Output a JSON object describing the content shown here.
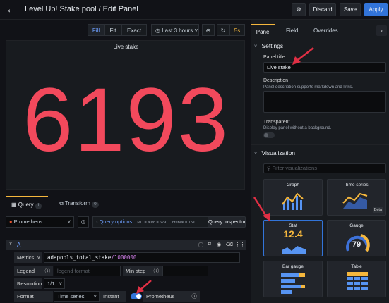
{
  "header": {
    "title": "Level Up! Stake pool / Edit Panel",
    "discard": "Discard",
    "save": "Save",
    "apply": "Apply"
  },
  "toolbar": {
    "fill": "Fill",
    "fit": "Fit",
    "exact": "Exact",
    "time_range": "Last 3 hours",
    "refresh": "5s"
  },
  "panel": {
    "title": "Live stake",
    "value": "6193",
    "value_color": "#f2495c"
  },
  "query_tabs": [
    {
      "label": "Query",
      "count": "1"
    },
    {
      "label": "Transform",
      "count": "0"
    }
  ],
  "query": {
    "datasource": "Prometheus",
    "options_link": "Query options",
    "md_info": "MD = auto = 679",
    "interval": "Interval = 15s",
    "inspector": "Query inspector",
    "ref": "A",
    "metrics_label": "Metrics",
    "metrics_value_name": "adapools_total_stake",
    "metrics_value_op": "/1000000",
    "legend_label": "Legend",
    "legend_placeholder": "legend format",
    "minstep_label": "Min step",
    "resolution_label": "Resolution",
    "resolution_value": "1/1",
    "format_label": "Format",
    "format_value": "Time series",
    "instant_label": "Instant",
    "prom_label": "Prometheus"
  },
  "side_tabs": [
    "Panel",
    "Field",
    "Overrides"
  ],
  "settings": {
    "section": "Settings",
    "panel_title_label": "Panel title",
    "panel_title_value": "Live stake",
    "description_label": "Description",
    "description_help": "Panel description supports markdown and links.",
    "transparent_label": "Transparent",
    "transparent_help": "Display panel without a background."
  },
  "visualization": {
    "section": "Visualization",
    "filter_placeholder": "Filter visualizations",
    "items": [
      {
        "name": "Graph"
      },
      {
        "name": "Time series",
        "badge": "Beta"
      },
      {
        "name": "Stat",
        "stat_value": "12.4"
      },
      {
        "name": "Gauge",
        "gauge_value": "79"
      },
      {
        "name": "Bar gauge"
      },
      {
        "name": "Table"
      }
    ]
  }
}
